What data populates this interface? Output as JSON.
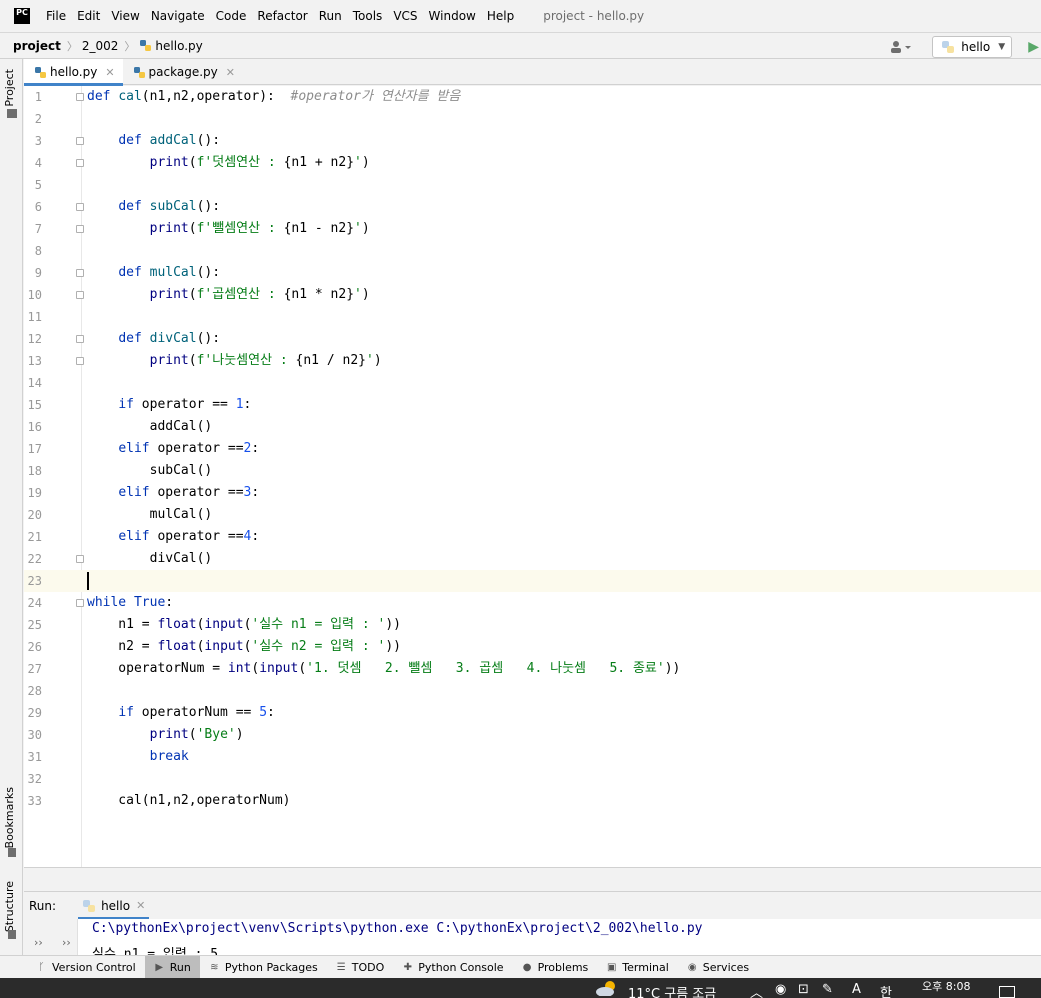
{
  "menubar": {
    "logo": "PC",
    "items": [
      "File",
      "Edit",
      "View",
      "Navigate",
      "Code",
      "Refactor",
      "Run",
      "Tools",
      "VCS",
      "Window",
      "Help"
    ],
    "window_title": "project - hello.py"
  },
  "navbar": {
    "crumbs": [
      "project",
      "2_002",
      "hello.py"
    ],
    "run_config": "hello"
  },
  "left_tools": {
    "project": "Project",
    "bookmarks": "Bookmarks",
    "structure": "Structure"
  },
  "tabs": [
    {
      "label": "hello.py",
      "active": true
    },
    {
      "label": "package.py",
      "active": false
    }
  ],
  "editor": {
    "line_numbers": [
      "1",
      "2",
      "3",
      "4",
      "5",
      "6",
      "7",
      "8",
      "9",
      "10",
      "11",
      "12",
      "13",
      "14",
      "15",
      "16",
      "17",
      "18",
      "19",
      "20",
      "21",
      "22",
      "23",
      "24",
      "25",
      "26",
      "27",
      "28",
      "29",
      "30",
      "31",
      "32",
      "33"
    ],
    "current_line": 23
  },
  "run_panel": {
    "label": "Run:",
    "tab": "hello",
    "output": [
      "C:\\pythonEx\\project\\venv\\Scripts\\python.exe C:\\pythonEx\\project\\2_002\\hello.py",
      "실수 n1 = 입력 : 5"
    ]
  },
  "bottom_tools": [
    "Version Control",
    "Run",
    "Python Packages",
    "TODO",
    "Python Console",
    "Problems",
    "Terminal",
    "Services"
  ],
  "taskbar": {
    "weather": "11°C  구름 조금",
    "ime_a": "A",
    "ime_han": "한",
    "clock": "오후 8:08"
  },
  "colors": {
    "keyword": "#0033b3",
    "function": "#00627a",
    "string": "#067d17",
    "number": "#1750eb",
    "comment": "#8c8c8c",
    "accent": "#4083c9"
  }
}
